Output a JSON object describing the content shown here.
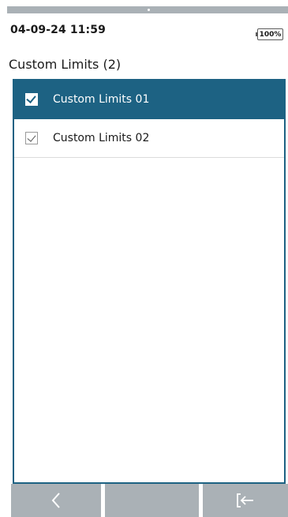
{
  "status": {
    "datetime": "04-09-24 11:59",
    "battery": "100%"
  },
  "screen": {
    "title": "Custom Limits (2)"
  },
  "list": {
    "items": [
      {
        "label": "Custom Limits 01",
        "checked": true,
        "selected": true
      },
      {
        "label": "Custom Limits 02",
        "checked": true,
        "selected": false
      }
    ]
  },
  "softkeys": [
    {
      "icon": "back-arrow-icon"
    },
    {
      "icon": ""
    },
    {
      "icon": "exit-icon"
    }
  ],
  "colors": {
    "accent": "#1d6283",
    "softkey": "#aab1b6"
  }
}
